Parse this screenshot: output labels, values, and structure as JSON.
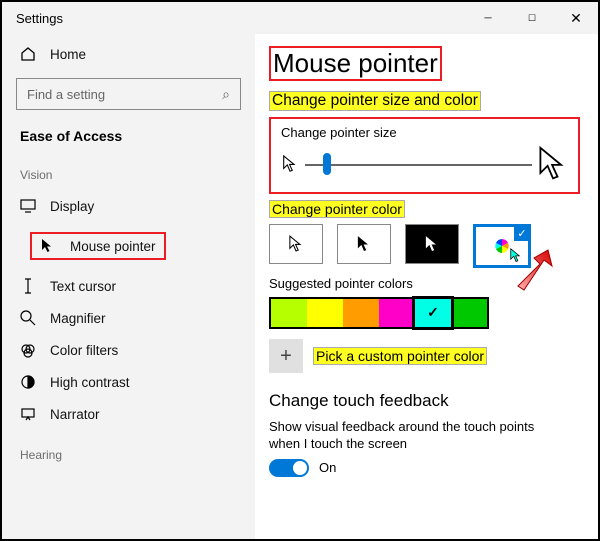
{
  "window": {
    "title": "Settings"
  },
  "sidebar": {
    "home": "Home",
    "search_placeholder": "Find a setting",
    "category": "Ease of Access",
    "groups": {
      "vision_label": "Vision",
      "hearing_label": "Hearing"
    },
    "items": {
      "display": "Display",
      "mouse_pointer": "Mouse pointer",
      "text_cursor": "Text cursor",
      "magnifier": "Magnifier",
      "color_filters": "Color filters",
      "high_contrast": "High contrast",
      "narrator": "Narrator"
    }
  },
  "main": {
    "title": "Mouse pointer",
    "section_size_color": "Change pointer size and color",
    "size_label": "Change pointer size",
    "color_label": "Change pointer color",
    "suggested_label": "Suggested pointer colors",
    "custom_label": "Pick a custom pointer color",
    "touch_heading": "Change touch feedback",
    "touch_desc": "Show visual feedback around the touch points when I touch the screen",
    "toggle_state": "On",
    "slider_pos_pct": 8,
    "pointer_styles": [
      "white",
      "black",
      "inverted",
      "custom"
    ],
    "pointer_style_selected": "custom",
    "swatch_colors": [
      "#b6ff00",
      "#ffff00",
      "#ff9d00",
      "#ff00c8",
      "#00ffe5",
      "#00c800"
    ],
    "swatch_selected_index": 4
  }
}
